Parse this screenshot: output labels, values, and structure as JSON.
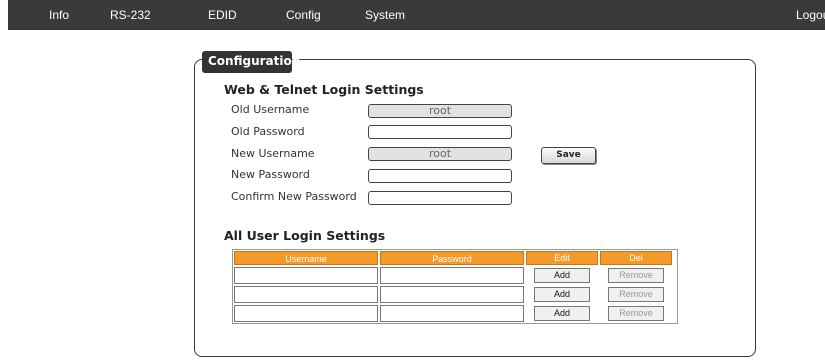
{
  "nav": {
    "items": [
      "Info",
      "RS-232",
      "EDID",
      "Config",
      "System"
    ],
    "logout": "Logou"
  },
  "panel": {
    "title": "Configuration",
    "web_section": {
      "title": "Web & Telnet Login Settings",
      "old_username_label": "Old Username",
      "old_username_value": "root",
      "old_password_label": "Old Password",
      "new_username_label": "New Username",
      "new_username_value": "root",
      "new_password_label": "New Password",
      "confirm_password_label": "Confirm New Password",
      "save_label": "Save"
    },
    "users_section": {
      "title": "All User Login Settings",
      "columns": [
        "Username",
        "Password",
        "Edit",
        "Del"
      ],
      "rows": [
        {
          "username": "",
          "password": "",
          "edit": "Add",
          "del": "Remove"
        },
        {
          "username": "",
          "password": "",
          "edit": "Add",
          "del": "Remove"
        },
        {
          "username": "",
          "password": "",
          "edit": "Add",
          "del": "Remove"
        }
      ]
    }
  },
  "colors": {
    "nav_bg": "#3a3a3a",
    "table_header": "#f39a2a",
    "readonly_field": "#e2e2e0"
  }
}
